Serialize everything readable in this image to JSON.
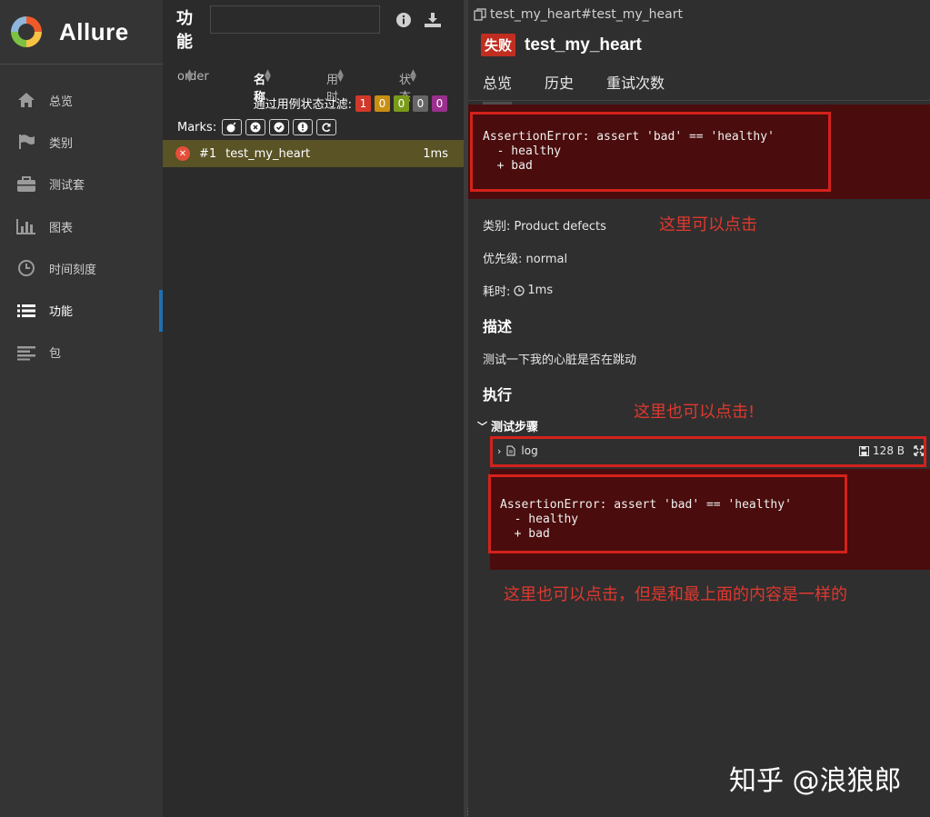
{
  "app": {
    "name": "Allure"
  },
  "sidebar": {
    "items": [
      {
        "label": "总览",
        "icon": "home-icon"
      },
      {
        "label": "类别",
        "icon": "flag-icon"
      },
      {
        "label": "测试套",
        "icon": "briefcase-icon"
      },
      {
        "label": "图表",
        "icon": "bar-chart-icon"
      },
      {
        "label": "时间刻度",
        "icon": "clock-icon"
      },
      {
        "label": "功能",
        "icon": "list-icon",
        "active": true
      },
      {
        "label": "包",
        "icon": "align-left-icon"
      }
    ]
  },
  "tree": {
    "title": "功能",
    "search_value": "",
    "columns": {
      "order": "order",
      "name": "名称",
      "duration": "用时",
      "status": "状态"
    },
    "filter_label": "通过用例状态过滤:",
    "status_counts": [
      {
        "value": "1",
        "color": "#d0392a"
      },
      {
        "value": "0",
        "color": "#c98f12"
      },
      {
        "value": "0",
        "color": "#7a9a1a"
      },
      {
        "value": "0",
        "color": "#666666"
      },
      {
        "value": "0",
        "color": "#9b2f8e"
      }
    ],
    "marks_label": "Marks:",
    "marks": [
      "bomb-icon",
      "x-circle-icon",
      "check-circle-icon",
      "exclamation-icon",
      "refresh-icon"
    ],
    "rows": [
      {
        "order": "#1",
        "name": "test_my_heart",
        "duration": "1ms",
        "status": "failed"
      }
    ]
  },
  "detail": {
    "breadcrumb": "test_my_heart#test_my_heart",
    "status_label": "失败",
    "title": "test_my_heart",
    "tabs": [
      "总览",
      "历史",
      "重试次数"
    ],
    "error_message": "AssertionError: assert 'bad' == 'healthy'\n  - healthy\n  + bad",
    "category": "类别: Product defects",
    "severity": "优先级: normal",
    "duration_label": "耗时:",
    "duration_value": "1ms",
    "description_heading": "描述",
    "description": "测试一下我的心脏是否在跳动",
    "execution_heading": "执行",
    "steps_label": "测试步骤",
    "attachment": {
      "name": "log",
      "size": "128 B"
    },
    "step_error": "AssertionError: assert 'bad' == 'healthy'\n  - healthy\n  + bad"
  },
  "annotations": {
    "a1": "这里可以点击",
    "a2": "这里也可以点击!",
    "a3": "这里也可以点击，但是和最上面的内容是一样的"
  },
  "watermark": "知乎 @浪狼郎",
  "colors": {
    "accent": "#1f6fb2",
    "failed": "#c12e1f",
    "annotation": "#d3221c"
  }
}
